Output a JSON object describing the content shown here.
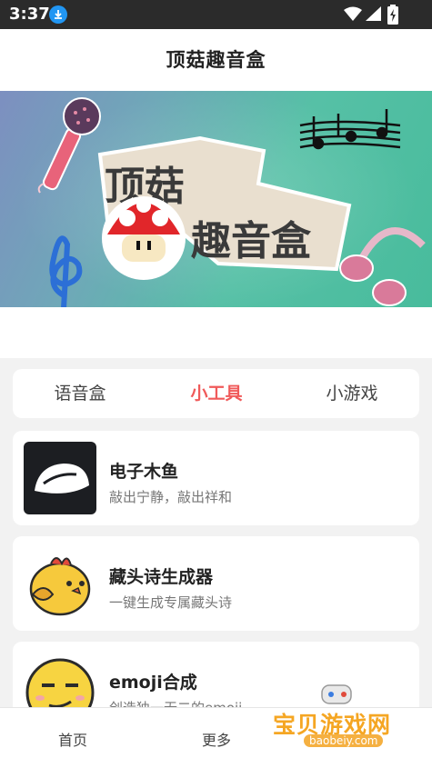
{
  "status": {
    "time": "3:37"
  },
  "header": {
    "title": "顶菇趣音盒"
  },
  "banner": {
    "line1": "顶菇",
    "line2": "趣音盒"
  },
  "tabs": [
    {
      "label": "语音盒",
      "active": false
    },
    {
      "label": "小工具",
      "active": true
    },
    {
      "label": "小游戏",
      "active": false
    }
  ],
  "cards": [
    {
      "title": "电子木鱼",
      "desc": "敲出宁静，敲出祥和",
      "icon": "wooden-fish-icon"
    },
    {
      "title": "藏头诗生成器",
      "desc": "一键生成专属藏头诗",
      "icon": "chick-icon"
    },
    {
      "title": "emoji合成",
      "desc": "创造独一无二的emoji",
      "icon": "emoji-face-icon"
    }
  ],
  "nav": {
    "home": "首页",
    "more": "更多"
  },
  "watermark": {
    "text": "宝贝游戏网",
    "url": "baobeiy.com"
  },
  "colors": {
    "accent": "#f05a5a",
    "statusbar": "#2b2b2b"
  }
}
